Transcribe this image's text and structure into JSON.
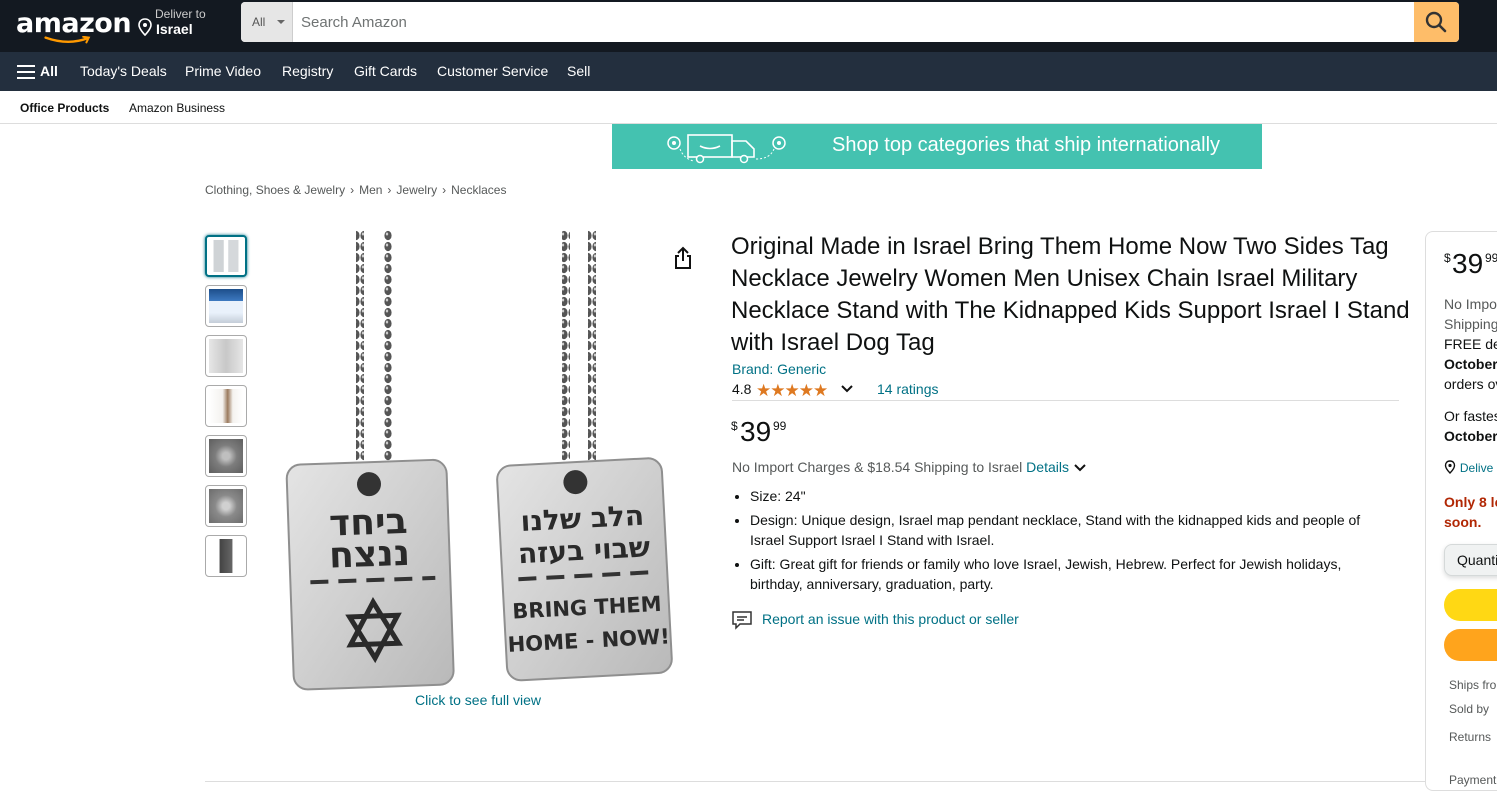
{
  "header": {
    "logo": "amazon",
    "deliver_line1": "Deliver to",
    "deliver_line2": "Israel",
    "search_category": "All",
    "search_placeholder": "Search Amazon"
  },
  "nav": {
    "all": "All",
    "items": [
      "Today's Deals",
      "Prime Video",
      "Registry",
      "Gift Cards",
      "Customer Service",
      "Sell"
    ]
  },
  "subnav": {
    "items": [
      "Office Products",
      "Amazon Business"
    ]
  },
  "banner": {
    "text": "Shop top categories that ship internationally"
  },
  "breadcrumb": [
    "Clothing, Shoes & Jewelry",
    "Men",
    "Jewelry",
    "Necklaces"
  ],
  "gallery": {
    "thumbnail_count": 7,
    "caption": "Click to see full view",
    "tag_left": {
      "line1": "ביחד",
      "line2": "ננצח"
    },
    "tag_right": {
      "line1": "הלב שלנו",
      "line2": "שבוי בעזה",
      "line3": "BRING THEM",
      "line4": "HOME - NOW!"
    }
  },
  "product": {
    "title": "Original Made in Israel Bring Them Home Now Two Sides Tag Necklace Jewelry Women Men Unisex Chain Israel Military Necklace Stand with The Kidnapped Kids Support Israel I Stand with Israel Dog Tag",
    "brand": "Brand: Generic",
    "rating": "4.8",
    "stars": 4.8,
    "ratings_count": "14 ratings",
    "price_symbol": "$",
    "price_whole": "39",
    "price_fraction": "99",
    "shipping_text": "No Import Charges & $18.54 Shipping to Israel",
    "shipping_details": "Details",
    "bullets": [
      "Size: 24\"",
      "Design: Unique design, Israel map pendant necklace, Stand with the kidnapped kids and people of Israel Support Israel I Stand with Israel.",
      "Gift: Great gift for friends or family who love Israel, Jewish, Hebrew. Perfect for Jewish holidays, birthday, anniversary, graduation, party."
    ],
    "report_link": "Report an issue with this product or seller"
  },
  "buybox": {
    "price_symbol": "$",
    "price_whole": "39",
    "price_fraction": "99",
    "line1": "No Impo",
    "line2": "Shipping",
    "line3": "FREE del",
    "line4": "October",
    "line5": "orders ov",
    "line6": "Or fastes",
    "line7": "October",
    "deliver": "Delive",
    "stock_line1": "Only 8 le",
    "stock_line2": "soon.",
    "quantity": "Quanti",
    "ships_from": "Ships fro",
    "sold_by": "Sold by",
    "returns": "Returns",
    "payment": "Payment"
  },
  "colors": {
    "nav_dark": "#131921",
    "nav_secondary": "#232f3e",
    "search_button": "#febd69",
    "link": "#007185",
    "star": "#de7921",
    "banner": "#44c2b0",
    "add_to_cart": "#ffd814",
    "buy_now": "#ffa41c",
    "stock_red": "#b12704"
  }
}
